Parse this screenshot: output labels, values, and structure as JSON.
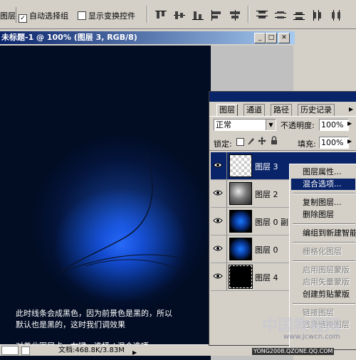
{
  "options_bar": {
    "layer_label": "图层",
    "auto_select_label": "自动选择组",
    "auto_select_checked": true,
    "show_transform_label": "显示变换控件",
    "show_transform_checked": false
  },
  "document": {
    "title": "未标题-1 @ 100% (图层 3, RGB/8)",
    "annotation_line1": "此时线条会成黑色，因为前景色是黑的，所以",
    "annotation_line2": "默认也是黑的，这时我们调效果",
    "annotation_line3": "对着此图层点，右键，选择 / 混合选项"
  },
  "status_bar": {
    "doc_size": "文档:468.8K/3.83M"
  },
  "layers_panel": {
    "tabs": [
      "图层",
      "通道",
      "路径",
      "历史记录"
    ],
    "blend_mode": "正常",
    "opacity_label": "不透明度:",
    "opacity_value": "100%",
    "lock_label": "锁定:",
    "fill_label": "填充:",
    "fill_value": "100%",
    "layers": [
      {
        "name": "图层 3",
        "selected": true
      },
      {
        "name": "图层 2",
        "selected": false
      },
      {
        "name": "图层 0 副",
        "selected": false
      },
      {
        "name": "图层 0",
        "selected": false
      },
      {
        "name": "图层 4",
        "selected": false
      }
    ]
  },
  "context_menu": {
    "items": [
      {
        "label": "图层属性...",
        "enabled": true,
        "highlighted": false
      },
      {
        "label": "混合选项...",
        "enabled": true,
        "highlighted": true
      },
      {
        "label": "复制图层...",
        "enabled": true,
        "highlighted": false
      },
      {
        "label": "删除图层",
        "enabled": true,
        "highlighted": false
      },
      {
        "label": "编组到新建智能",
        "enabled": true,
        "highlighted": false
      },
      {
        "label": "栅格化图层",
        "enabled": false,
        "highlighted": false
      },
      {
        "label": "启用图层蒙版",
        "enabled": false,
        "highlighted": false
      },
      {
        "label": "启用矢量蒙版",
        "enabled": false,
        "highlighted": false
      },
      {
        "label": "创建剪贴蒙版",
        "enabled": true,
        "highlighted": false
      },
      {
        "label": "链接图层",
        "enabled": false,
        "highlighted": false
      },
      {
        "label": "选择链接图层",
        "enabled": false,
        "highlighted": false
      }
    ]
  },
  "watermark": {
    "text": "中国教程网",
    "url": "www.jcwcn.com",
    "tag": "YONG2008.QZONE.QQ.COM"
  },
  "colors": {
    "titlebar": "#0a246a",
    "chrome": "#d4d0c8",
    "highlight": "#0a246a"
  }
}
